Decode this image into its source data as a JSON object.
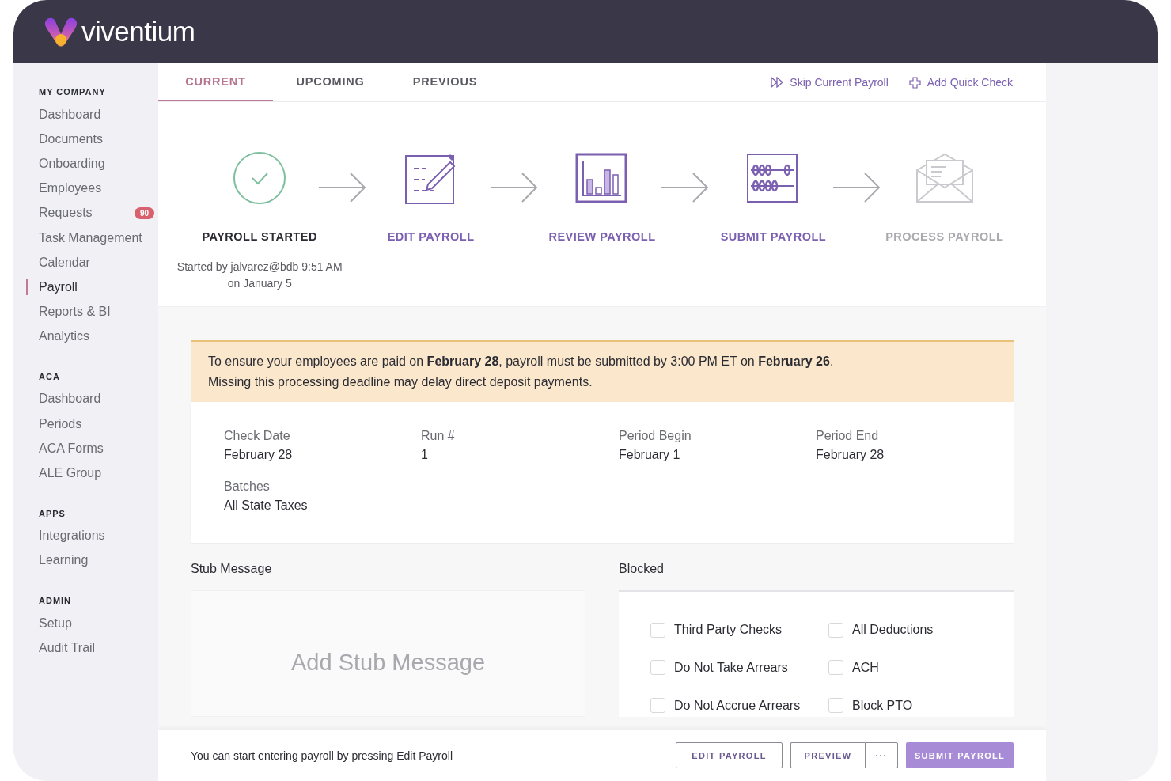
{
  "brand": {
    "name": "viventium"
  },
  "sidebar": {
    "sections": [
      {
        "heading": "MY COMPANY",
        "items": [
          {
            "label": "Dashboard",
            "selected": false
          },
          {
            "label": "Documents",
            "selected": false
          },
          {
            "label": "Onboarding",
            "selected": false
          },
          {
            "label": "Employees",
            "selected": false
          },
          {
            "label": "Requests",
            "selected": false,
            "badge": "90"
          },
          {
            "label": "Task Management",
            "selected": false
          },
          {
            "label": "Calendar",
            "selected": false
          },
          {
            "label": "Payroll",
            "selected": true
          },
          {
            "label": "Reports & BI",
            "selected": false
          },
          {
            "label": "Analytics",
            "selected": false
          }
        ]
      },
      {
        "heading": "ACA",
        "items": [
          {
            "label": "Dashboard",
            "selected": false
          },
          {
            "label": "Periods",
            "selected": false
          },
          {
            "label": "ACA Forms",
            "selected": false
          },
          {
            "label": "ALE Group",
            "selected": false
          }
        ]
      },
      {
        "heading": "APPS",
        "items": [
          {
            "label": "Integrations",
            "selected": false
          },
          {
            "label": "Learning",
            "selected": false
          }
        ]
      },
      {
        "heading": "ADMIN",
        "items": [
          {
            "label": "Setup",
            "selected": false
          },
          {
            "label": "Audit Trail",
            "selected": false
          }
        ]
      }
    ]
  },
  "tabs": [
    {
      "label": "CURRENT",
      "selected": true
    },
    {
      "label": "UPCOMING",
      "selected": false
    },
    {
      "label": "PREVIOUS",
      "selected": false
    }
  ],
  "actions": [
    {
      "label": "Skip Current Payroll"
    },
    {
      "label": "Add Quick Check"
    }
  ],
  "steps": [
    {
      "label": "PAYROLL STARTED",
      "completed": true,
      "disabled": false,
      "note_lines": [
        "Started by jalvarez@bdb 9:51 AM",
        "on January 5"
      ]
    },
    {
      "label": "EDIT PAYROLL",
      "completed": false,
      "disabled": false
    },
    {
      "label": "REVIEW PAYROLL",
      "completed": false,
      "disabled": false
    },
    {
      "label": "SUBMIT PAYROLL",
      "completed": false,
      "disabled": false
    },
    {
      "label": "PROCESS PAYROLL",
      "completed": false,
      "disabled": true
    }
  ],
  "alert": {
    "lines": [
      "To ensure your employees are paid on **February 28**, payroll must be submitted by 3:00 PM ET on **February 26**.",
      "Missing this processing deadline may delay direct deposit payments."
    ]
  },
  "details": [
    {
      "label": "Check Date",
      "value": "February 28"
    },
    {
      "label": "Run #",
      "value": "1"
    },
    {
      "label": "Period Begin",
      "value": "February 1"
    },
    {
      "label": "Period End",
      "value": "February 28"
    },
    {
      "label": "Batches",
      "value": "All State Taxes"
    }
  ],
  "stub": {
    "heading": "Stub Message",
    "placeholder": "Add Stub Message"
  },
  "blocked": {
    "heading": "Blocked",
    "options": [
      {
        "label": "Third Party Checks",
        "checked": false
      },
      {
        "label": "All Deductions",
        "checked": false
      },
      {
        "label": "Do Not Take Arrears",
        "checked": false
      },
      {
        "label": "ACH",
        "checked": false
      },
      {
        "label": "Do Not Accrue Arrears",
        "checked": false
      },
      {
        "label": "Block PTO",
        "checked": false
      }
    ]
  },
  "footer": {
    "message": "You can start entering payroll by pressing Edit Payroll",
    "buttons": [
      {
        "label": "EDIT PAYROLL",
        "kind": "outline"
      },
      {
        "label": "PREVIEW",
        "kind": "split-main"
      },
      {
        "label": "···",
        "kind": "split-more"
      },
      {
        "label": "SUBMIT PAYROLL",
        "kind": "primary"
      }
    ]
  }
}
